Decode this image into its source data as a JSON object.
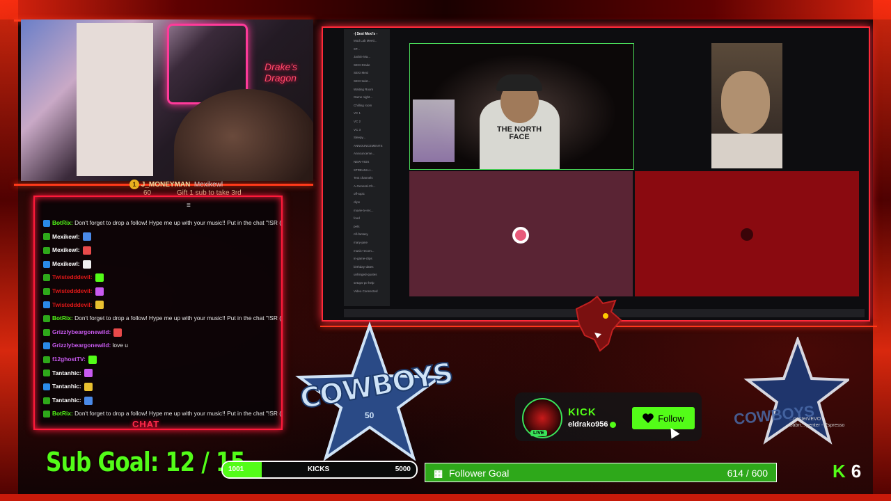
{
  "alert": {
    "coin": "1",
    "name": "J_MONEYMAN",
    "count": "60",
    "gifter": "Mexikewl",
    "gift_text": "Gift 1 sub to take 3rd"
  },
  "chat": {
    "label": "CHAT",
    "messages": [
      {
        "user": "BotRix:",
        "text": " Don't forget to drop a follow! Hype me up with your music!! Put in the chat \"!SR (song)",
        "color": "#53fc18"
      },
      {
        "user": "Mexikewl:",
        "text": "",
        "color": "#ffffff"
      },
      {
        "user": "Mexikewl:",
        "text": "",
        "color": "#ffffff"
      },
      {
        "user": "Mexikewl:",
        "text": "",
        "color": "#ffffff"
      },
      {
        "user": "Twistedddevil:",
        "text": "",
        "color": "#e01818"
      },
      {
        "user": "Twistedddevil:",
        "text": "",
        "color": "#e01818"
      },
      {
        "user": "Twistedddevil:",
        "text": "",
        "color": "#e01818"
      },
      {
        "user": "BotRix:",
        "text": " Don't forget to drop a follow! Hype me up with your music!! Put in the chat \"!SR (song)",
        "color": "#53fc18"
      },
      {
        "user": "Grizzlybeargonewild:",
        "text": "",
        "color": "#c85af0"
      },
      {
        "user": "Grizzlybeargonewild:",
        "text": " love u",
        "color": "#c85af0"
      },
      {
        "user": "f12ghostTV:",
        "text": "",
        "color": "#c85af0"
      },
      {
        "user": "Tantanhic:",
        "text": "",
        "color": "#ffffff"
      },
      {
        "user": "Tantanhic:",
        "text": "",
        "color": "#ffffff"
      },
      {
        "user": "Tantanhic:",
        "text": "",
        "color": "#ffffff"
      },
      {
        "user": "BotRix:",
        "text": " Don't forget to drop a follow! Hype me up with your music!! Put in the chat \"!SR (s",
        "color": "#53fc18"
      }
    ]
  },
  "webcam": {
    "sign": "Drake's Dragon"
  },
  "discord": {
    "server": "-| Sexi Mexi's -",
    "channels": [
      "Mod Lab Meeti...",
      "ST...",
      "Jackie Ma...",
      "SEXI Drake",
      "SEXI Mexi",
      "SEXI twist...",
      "Waiting Room",
      "Game night...",
      "Chilling room",
      "VC 1",
      "VC 2",
      "VC 3",
      "Sleepy...",
      "ANNOUNCEMENTS",
      "Announceme...",
      "NEW-VIDS",
      "STREAM-LI...",
      "Text channels",
      "A-General-Ch...",
      "off-topic",
      "clips",
      "movie-tv-rec...",
      "food",
      "pets",
      "nfl-fantasy",
      "mary-jane",
      "music-recom...",
      "in-game-clips",
      "birthday-dates",
      "unhinged-quotes",
      "setups-pc-help",
      "Video Connected"
    ]
  },
  "video_grid": {
    "shirt_text": "THE NORTH FACE"
  },
  "kick_card": {
    "brand": "KICK",
    "username": "eldrako956",
    "live": "LIVE",
    "follow_label": "Follow"
  },
  "logos": {
    "cowboys": "COWBOYS",
    "fifty": "50",
    "cowboys2": "COWBOYS",
    "vevo_line1": "...penterVEVO",
    "vevo_line2": "Sabri... penter - Espresso"
  },
  "sub_goal": {
    "label": "Sub Goal:",
    "current": "12",
    "sep": "/",
    "target": "15"
  },
  "kicks_bar": {
    "start": "1001",
    "label": "KICKS",
    "end": "5000",
    "fill_fraction": 0.2
  },
  "follower_goal": {
    "label": "Follower Goal",
    "value": "614 / 600",
    "fill_fraction": 1.0
  },
  "kick_counter": {
    "letter": "K",
    "count": "6"
  },
  "colors": {
    "kick_green": "#53fc18",
    "frame_red": "#ff2a3a",
    "bg": "#0a0405"
  }
}
